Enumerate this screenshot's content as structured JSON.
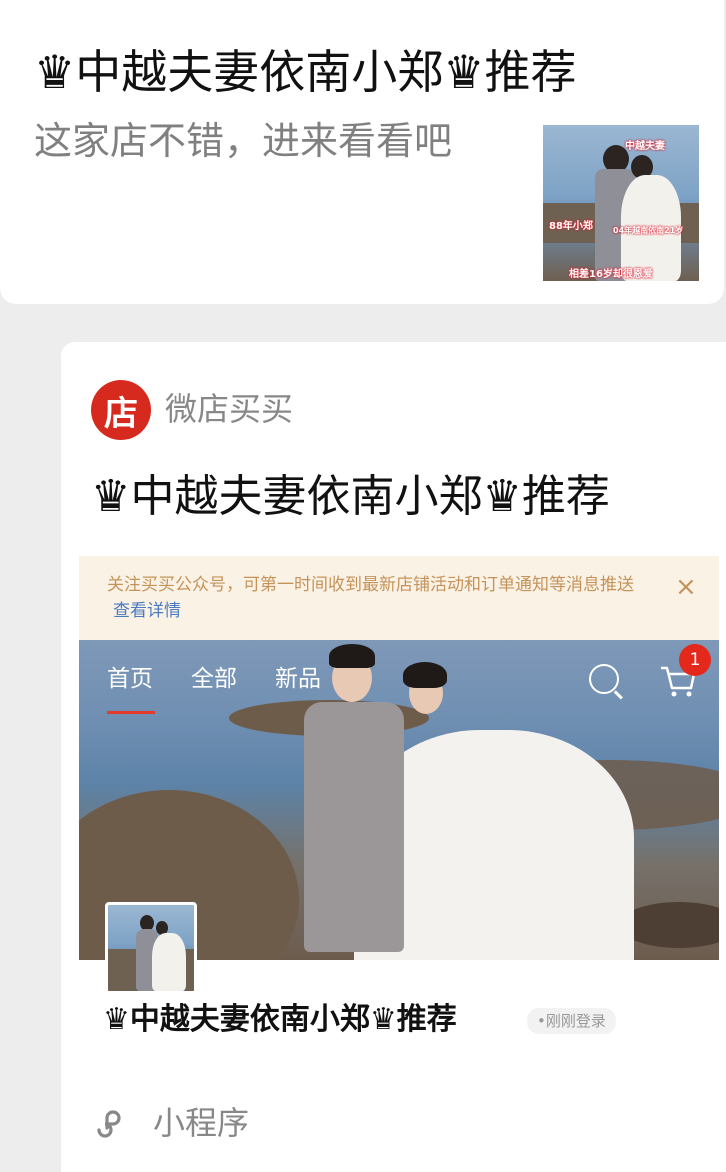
{
  "share": {
    "title": "♛中越夫妻依南小郑♛推荐",
    "description": "这家店不错，进来看看吧",
    "thumb_captions": [
      "中越夫妻",
      "88年小郑",
      "04年越南依南21岁",
      "相差16岁却很恩爱"
    ]
  },
  "miniprogram": {
    "app_name": "微店买买",
    "logo_char": "店",
    "title": "♛中越夫妻依南小郑♛推荐",
    "footer_label": "小程序"
  },
  "preview": {
    "notice_text": "关注买买公众号，可第一时间收到最新店铺活动和订单通知等消息推送",
    "notice_link": "查看详情",
    "notice_close": "×",
    "nav": {
      "tabs": [
        "首页",
        "全部",
        "新品"
      ],
      "cart_badge": "1"
    },
    "shop_name": "♛中越夫妻依南小郑♛推荐",
    "shop_status": "•刚刚登录"
  },
  "colors": {
    "brand_red": "#d72a1f",
    "notice_bg": "#fbf2e6",
    "link_blue": "#4a7bc0"
  }
}
